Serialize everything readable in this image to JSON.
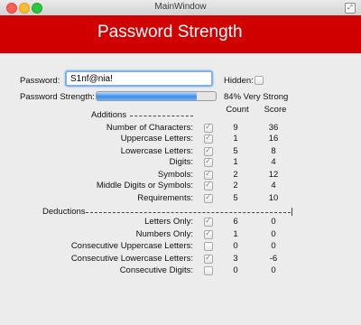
{
  "window": {
    "title": "MainWindow"
  },
  "banner": {
    "title": "Password Strength",
    "color": "#d10000"
  },
  "password": {
    "label": "Password:",
    "value": "S1nf@nia!"
  },
  "hidden": {
    "label": "Hidden:",
    "checked": false
  },
  "strength": {
    "label": "Password Strength:",
    "progress_percent": 84,
    "text": "84% Very Strong"
  },
  "columns": {
    "count": "Count",
    "score": "Score"
  },
  "additions": {
    "title": "Additions",
    "rows": [
      {
        "label": "Number of Characters:",
        "checked": true,
        "count": "9",
        "score": "36"
      },
      {
        "label": "Uppercase Letters:",
        "checked": true,
        "count": "1",
        "score": "16"
      },
      {
        "label": "Lowercase Letters:",
        "checked": true,
        "count": "5",
        "score": "8"
      },
      {
        "label": "Digits:",
        "checked": true,
        "count": "1",
        "score": "4"
      },
      {
        "label": "Symbols:",
        "checked": true,
        "count": "2",
        "score": "12"
      },
      {
        "label": "Middle Digits or Symbols:",
        "checked": true,
        "count": "2",
        "score": "4"
      },
      {
        "label": "Requirements:",
        "checked": true,
        "count": "5",
        "score": "10"
      }
    ]
  },
  "deductions": {
    "title": "Deductions",
    "rows": [
      {
        "label": "Letters Only:",
        "checked": true,
        "count": "6",
        "score": "0"
      },
      {
        "label": "Numbers Only:",
        "checked": true,
        "count": "1",
        "score": "0"
      },
      {
        "label": "Consecutive Uppercase Letters:",
        "checked": false,
        "count": "0",
        "score": "0"
      },
      {
        "label": "Consecutive Lowercase Letters:",
        "checked": true,
        "count": "3",
        "score": "-6"
      },
      {
        "label": "Consecutive Digits:",
        "checked": false,
        "count": "0",
        "score": "0"
      }
    ]
  }
}
